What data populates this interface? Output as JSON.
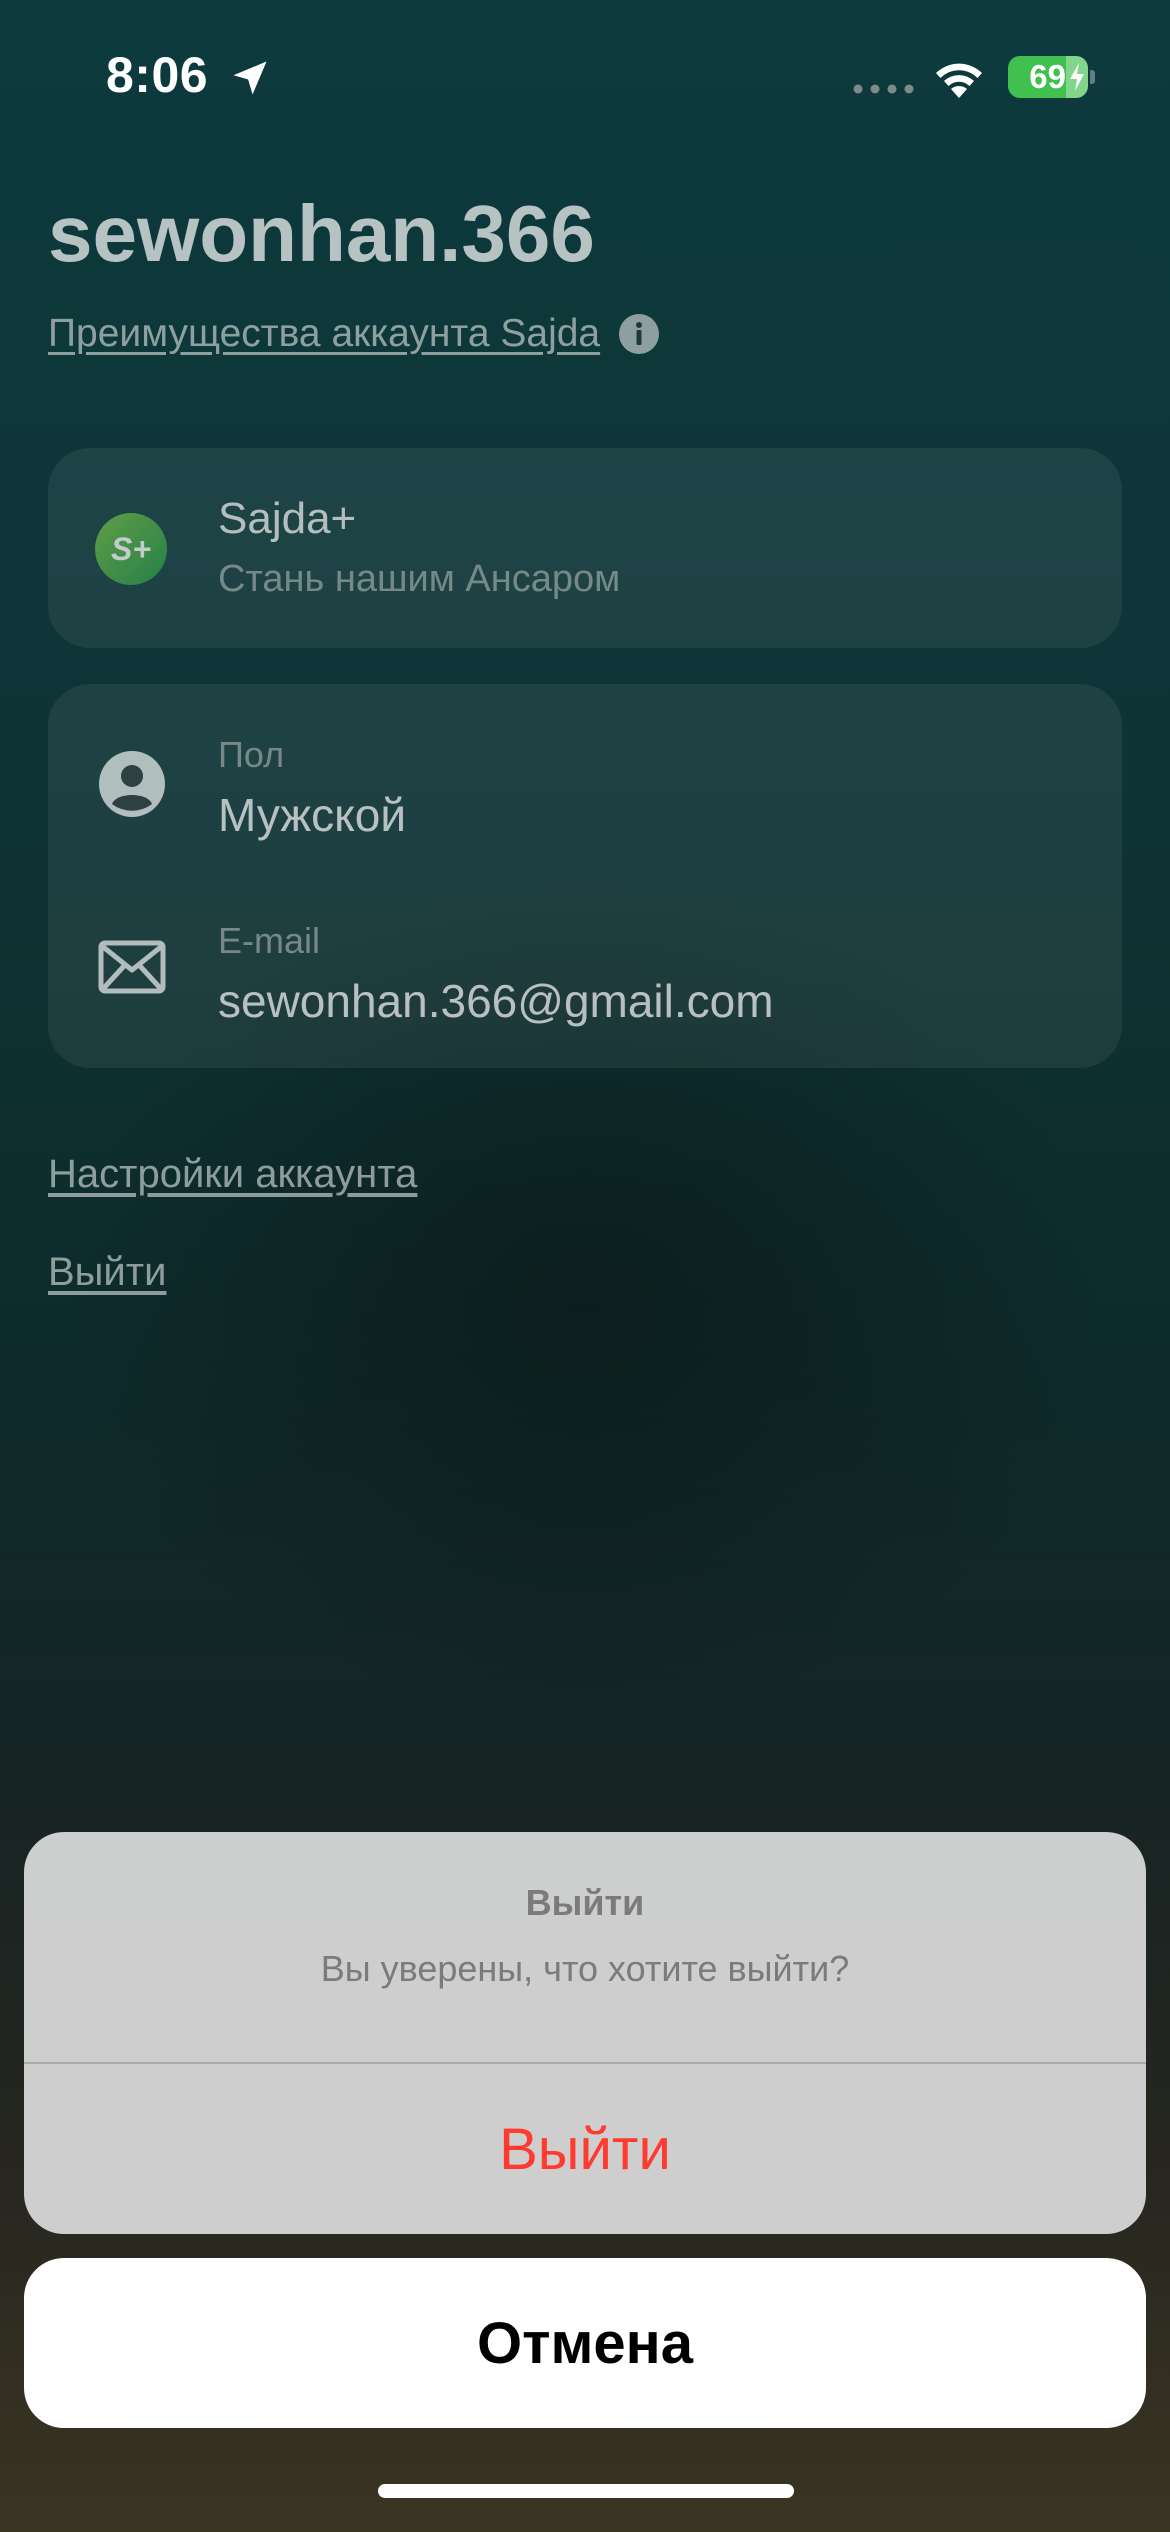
{
  "status_bar": {
    "time": "8:06",
    "battery": "69",
    "icons": [
      "location-arrow-icon",
      "signal-icon",
      "wifi-icon",
      "battery-charging-icon"
    ]
  },
  "profile": {
    "username": "sewonhan.366",
    "benefits_link": "Преимущества аккаунта Sajda",
    "premium": {
      "icon": "sajda-plus-icon",
      "title": "Sajda+",
      "subtitle": "Стань нашим Ансаром"
    },
    "gender": {
      "icon": "person-icon",
      "label": "Пол",
      "value": "Мужской"
    },
    "email": {
      "icon": "mail-icon",
      "label": "E-mail",
      "value": "sewonhan.366@gmail.com"
    },
    "settings_link": "Настройки аккаунта",
    "logout_link": "Выйти"
  },
  "action_sheet": {
    "title": "Выйти",
    "message": "Вы уверены, что хотите выйти?",
    "destructive_label": "Выйти",
    "cancel_label": "Отмена"
  },
  "colors": {
    "destructive": "#ff3b30",
    "battery": "#3fc04f",
    "accent_green": "#5cb85c"
  }
}
